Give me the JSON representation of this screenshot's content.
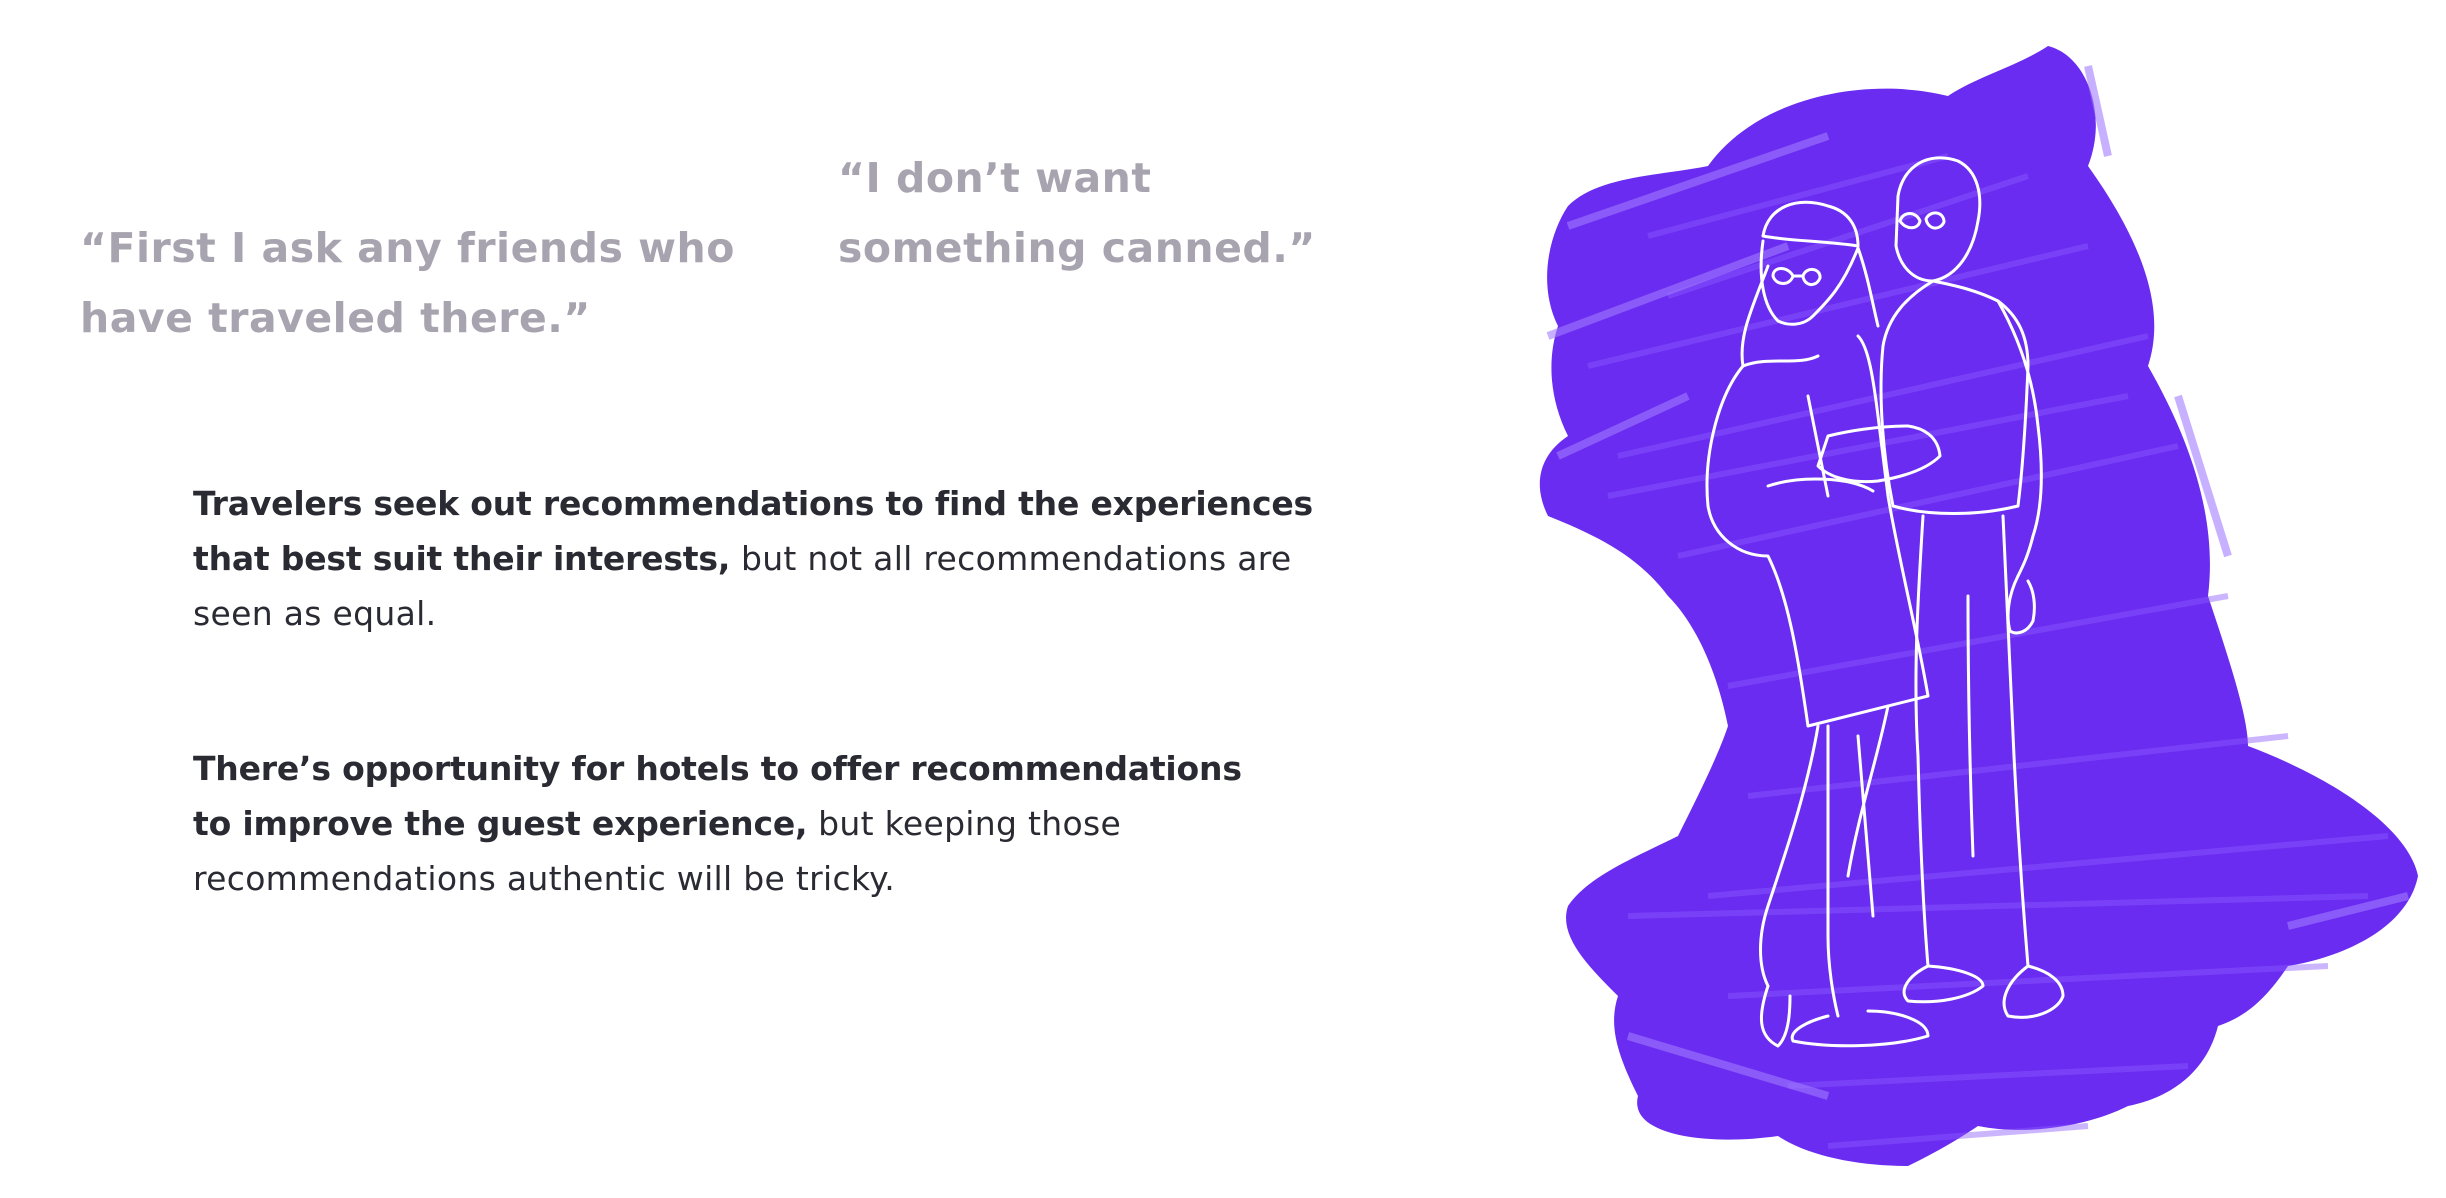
{
  "quotes": {
    "friends": {
      "line1": "“First I ask any friends who",
      "line2": "have traveled there.”"
    },
    "canned": {
      "line1": "“I don’t want",
      "line2": "something canned.”"
    }
  },
  "findings": {
    "recommendations": {
      "line1": "Travelers seek out recommendations to find the experiences",
      "line2_bold": "that best suit their interests,",
      "line2_rest": " but not all recommendations are",
      "line3": "seen as equal."
    },
    "opportunity": {
      "line1": "There’s opportunity for hotels to offer recommendations",
      "line2_bold": "to improve the guest experience,",
      "line2_rest": " but keeping those",
      "line3": "recommendations authentic will be tricky."
    }
  },
  "illustration": {
    "icon": "couple-illustration",
    "scribble_color": "#6a2cf0",
    "line_color": "#ffffff"
  }
}
